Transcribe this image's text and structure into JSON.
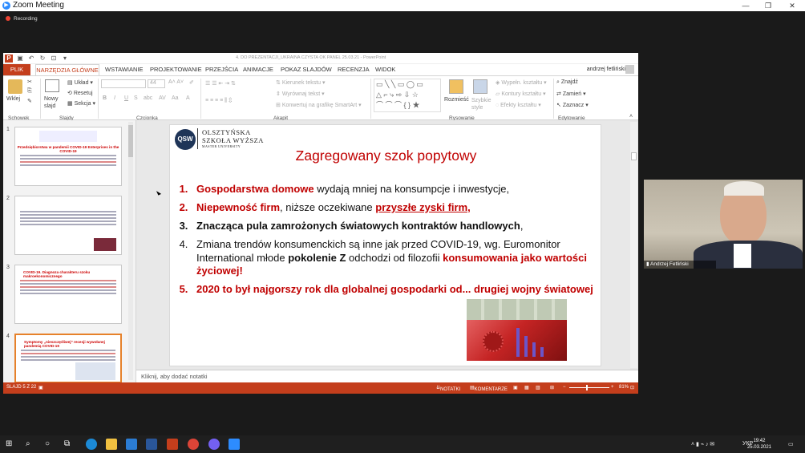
{
  "zoom": {
    "title": "Zoom Meeting",
    "recording": "Recording"
  },
  "ppt": {
    "document_title": "4. DO PREZENTACJI_UKRAINA CZYSTA OK PANEL 25.03.21 - PowerPoint",
    "user": "andrzej fetliński",
    "tabs": [
      "PLIK",
      "NARZĘDZIA GŁÓWNE",
      "WSTAWIANIE",
      "PROJEKTOWANIE",
      "PRZEJŚCIA",
      "ANIMACJE",
      "POKAZ SLAJDÓW",
      "RECENZJA",
      "WIDOK"
    ],
    "ribbon": {
      "wklej": "Wklej",
      "nowy_slajd": "Nowy slajd",
      "uklad": "Układ",
      "resetuj": "Resetuj",
      "sekcja": "Sekcja",
      "font_size": "44",
      "kierunek": "Kierunek tekstu",
      "wyrownaj": "Wyrównaj tekst",
      "konwertuj": "Konwertuj na grafikę SmartArt",
      "rozmiesc": "Rozmieść",
      "szybkie": "Szybkie style",
      "wypeln": "Wypełn. kształtu",
      "kontury": "Kontury kształtu",
      "efekty": "Efekty kształtu",
      "znajdz": "Znajdź",
      "zamien": "Zamień",
      "zaznacz": "Zaznacz",
      "groups": {
        "schowek": "Schowek",
        "slajdy": "Slajdy",
        "czcionka": "Czcionka",
        "akapit": "Akapit",
        "rysowanie": "Rysowanie",
        "edytowanie": "Edytowanie"
      }
    },
    "thumbnails": [
      {
        "num": "1",
        "title": "Przedsiębiorstwa w pandemii COVID-19\nEnterprises in the COVID-19"
      },
      {
        "num": "2",
        "title": ""
      },
      {
        "num": "3",
        "title": "COVID-19. Diagnoza charakteru szoku makroekonomicznego"
      },
      {
        "num": "4",
        "title": "Symptomy „nieszczęśliwej” recesji wywołanej pandemią COVID-19"
      }
    ],
    "slide": {
      "logo": "QSW",
      "school_line1": "OLSZTYŃSKA",
      "school_line2": "SZKOŁA WYŻSZA",
      "school_line3": "MASTER UNIVERSITY",
      "title": "Zagregowany szok popytowy",
      "bullets": [
        {
          "num": "1.",
          "parts": [
            {
              "t": "Gospodarstwa domowe",
              "s": "red"
            },
            {
              "t": " wydają mniej na konsumpcje i inwestycje,",
              "s": ""
            }
          ]
        },
        {
          "num": "2.",
          "parts": [
            {
              "t": "Niepewność firm",
              "s": "red"
            },
            {
              "t": ", niższe oczekiwane ",
              "s": ""
            },
            {
              "t": "przyszłe zyski firm,",
              "s": "redu"
            }
          ]
        },
        {
          "num": "3.",
          "parts": [
            {
              "t": "Znacząca pula zamrożonych  światowych kontraktów handlowych",
              "s": "blk"
            },
            {
              "t": ",",
              "s": ""
            }
          ]
        },
        {
          "num": "4.",
          "parts": [
            {
              "t": "Zmiana trendów  konsumenckich są inne jak przed COVID-19, wg. Euromonitor International młode  ",
              "s": ""
            },
            {
              "t": "pokolenie Z",
              "s": "blk"
            },
            {
              "t": " odchodzi od filozofii ",
              "s": ""
            },
            {
              "t": "konsumowania jako wartości życiowej!",
              "s": "red"
            }
          ]
        },
        {
          "num": "5.",
          "parts": [
            {
              "t": "2020 to był najgorszy rok dla globalnej gospodarki od... drugiej wojny światowej",
              "s": "red"
            }
          ]
        }
      ]
    },
    "notes_placeholder": "Kliknij, aby dodać notatki",
    "status": {
      "slide": "SLAJD 5 Z 22",
      "notes": "NOTATKI",
      "comments": "KOMENTARZE",
      "zoom": "81%"
    }
  },
  "webcam": {
    "name": "Andrzej Fetliński"
  },
  "taskbar": {
    "lang": "УКР",
    "time": "19:42",
    "date": "25.03.2021"
  },
  "colors": {
    "accent": "#c43e1c",
    "slide_red": "#c00000",
    "zoom_blue": "#2d8cff"
  }
}
